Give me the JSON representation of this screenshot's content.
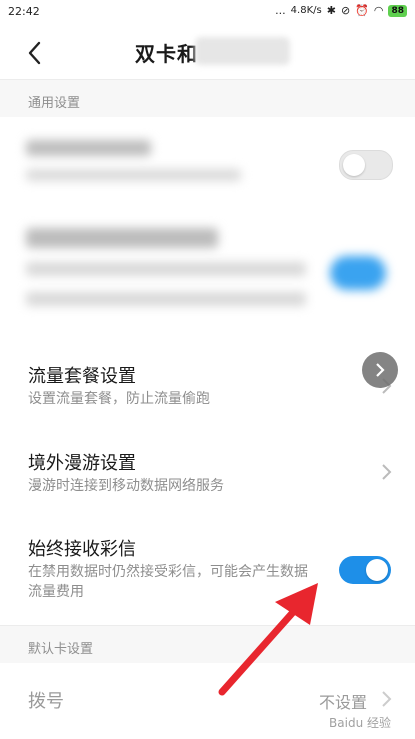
{
  "status_bar": {
    "time": "22:42",
    "icons_text": "...",
    "network_speed": "4.8K/s",
    "battery": "88"
  },
  "topbar": {
    "title": "双卡和",
    "back_icon": "chevron-left-icon"
  },
  "sections": {
    "general_header": "通用设置",
    "default_card_header": "默认卡设置"
  },
  "rows": {
    "data_plan": {
      "title": "流量套餐设置",
      "subtitle": "设置流量套餐，防止流量偷跑"
    },
    "roaming": {
      "title": "境外漫游设置",
      "subtitle": "漫游时连接到移动数据网络服务"
    },
    "mms": {
      "title": "始终接收彩信",
      "subtitle": "在禁用数据时仍然接受彩信，可能会产生数据流量费用"
    },
    "dial": {
      "title": "拨号",
      "value": "不设置"
    }
  },
  "colors": {
    "toggle_on": "#1e8fe8",
    "arrow": "#e8262e",
    "section_bg": "#f7f7f7"
  },
  "toggles": {
    "blurred_row_1": false,
    "blurred_row_2": true,
    "mms": true
  },
  "watermark": "Baidu 经验"
}
